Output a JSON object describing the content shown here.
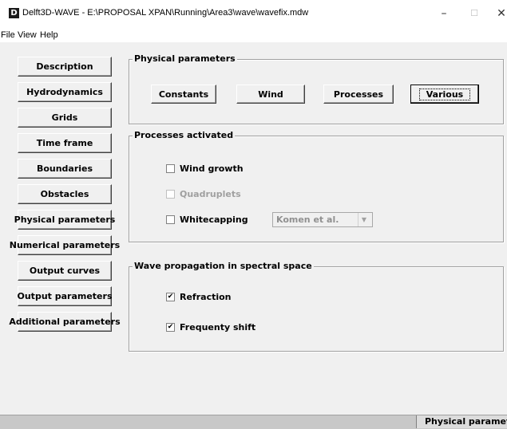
{
  "window": {
    "icon_letter": "D",
    "title": "Delft3D-WAVE - E:\\PROPOSAL XPAN\\Running\\Area3\\wave\\wavefix.mdw",
    "controls": {
      "minimize": "–",
      "maximize": "☐",
      "close": "✕"
    }
  },
  "menu": {
    "items": [
      "File",
      "View",
      "Help"
    ]
  },
  "nav": {
    "items": [
      "Description",
      "Hydrodynamics",
      "Grids",
      "Time frame",
      "Boundaries",
      "Obstacles",
      "Physical parameters",
      "Numerical parameters",
      "Output curves",
      "Output parameters",
      "Additional parameters"
    ],
    "active": "Physical parameters"
  },
  "physical": {
    "title": "Physical parameters",
    "tabs": [
      "Constants",
      "Wind",
      "Processes",
      "Various"
    ],
    "selected_tab": "Various"
  },
  "processes": {
    "title": "Processes activated",
    "wind_growth": {
      "label": "Wind growth",
      "checked": false
    },
    "quadruplets": {
      "label": "Quadruplets",
      "checked": false,
      "disabled": true
    },
    "whitecapping": {
      "label": "Whitecapping",
      "checked": false,
      "selected_option": "Komen et al."
    }
  },
  "propagation": {
    "title": "Wave propagation in spectral space",
    "refraction": {
      "label": "Refraction",
      "checked": true
    },
    "frequency_shift": {
      "label": "Frequenty shift",
      "checked": true
    }
  },
  "status": {
    "text": "Physical parameters"
  }
}
